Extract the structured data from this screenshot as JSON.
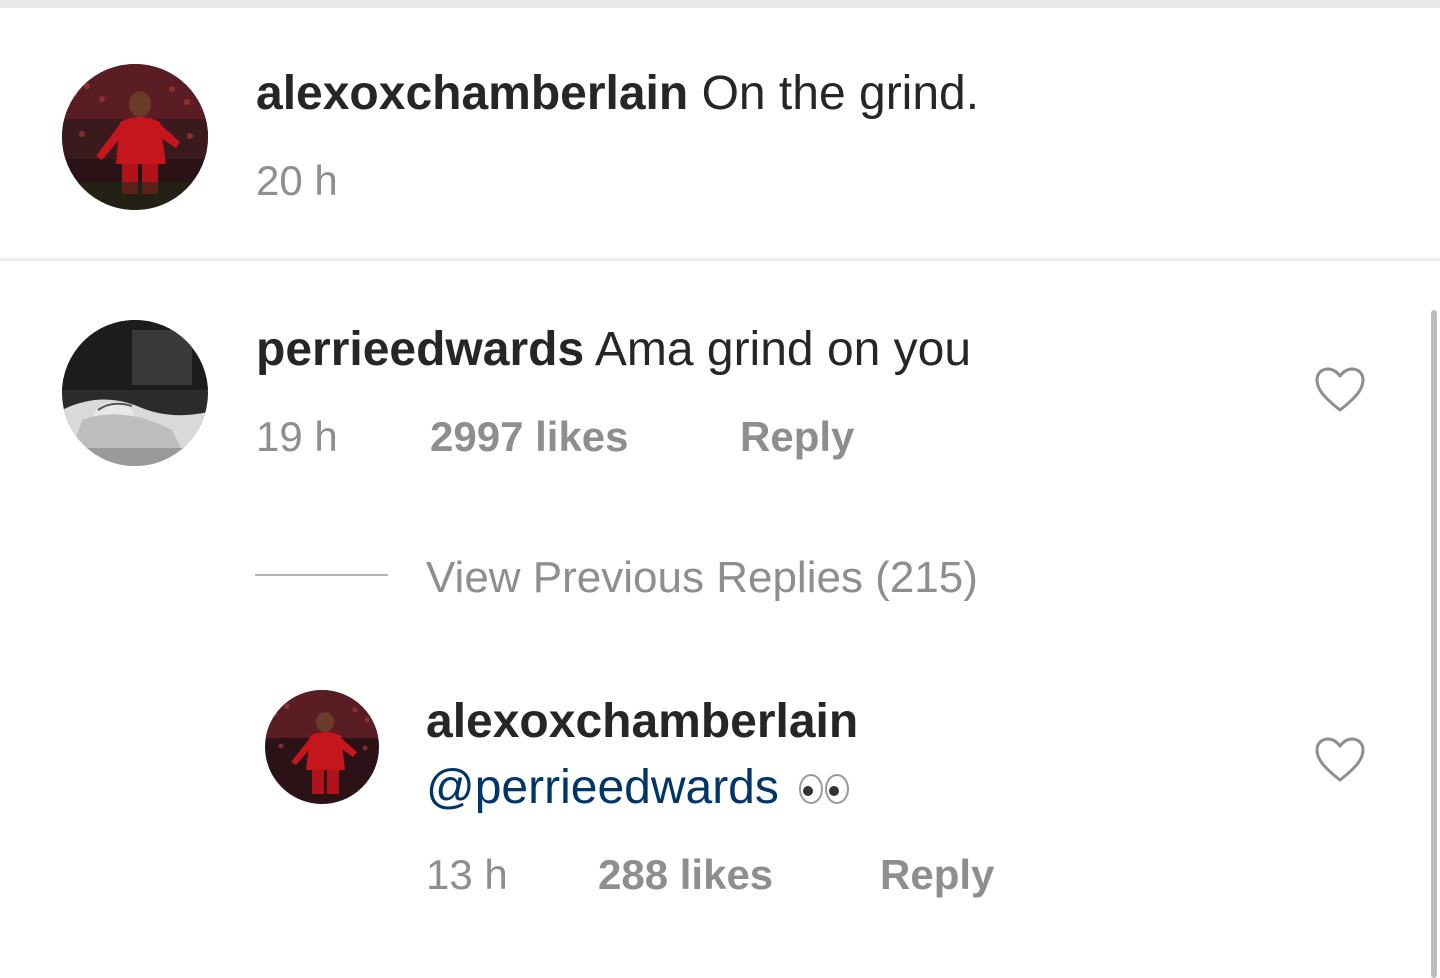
{
  "post": {
    "username": "alexoxchamberlain",
    "caption": "On the grind.",
    "time": "20 h"
  },
  "comment": {
    "username": "perrieedwards",
    "text": "Ama grind on you",
    "time": "19 h",
    "likes": "2997 likes",
    "reply_label": "Reply"
  },
  "view_previous_replies": "View Previous Replies (215)",
  "reply": {
    "username": "alexoxchamberlain",
    "mention": "@perrieedwards",
    "emoji": "eyes-emoji",
    "time": "13 h",
    "likes": "288 likes",
    "reply_label": "Reply"
  },
  "icons": {
    "like": "heart-outline-icon"
  },
  "colors": {
    "username": "#262626",
    "meta": "#8e8e8e",
    "mention": "#003569",
    "divider": "#ececec"
  }
}
